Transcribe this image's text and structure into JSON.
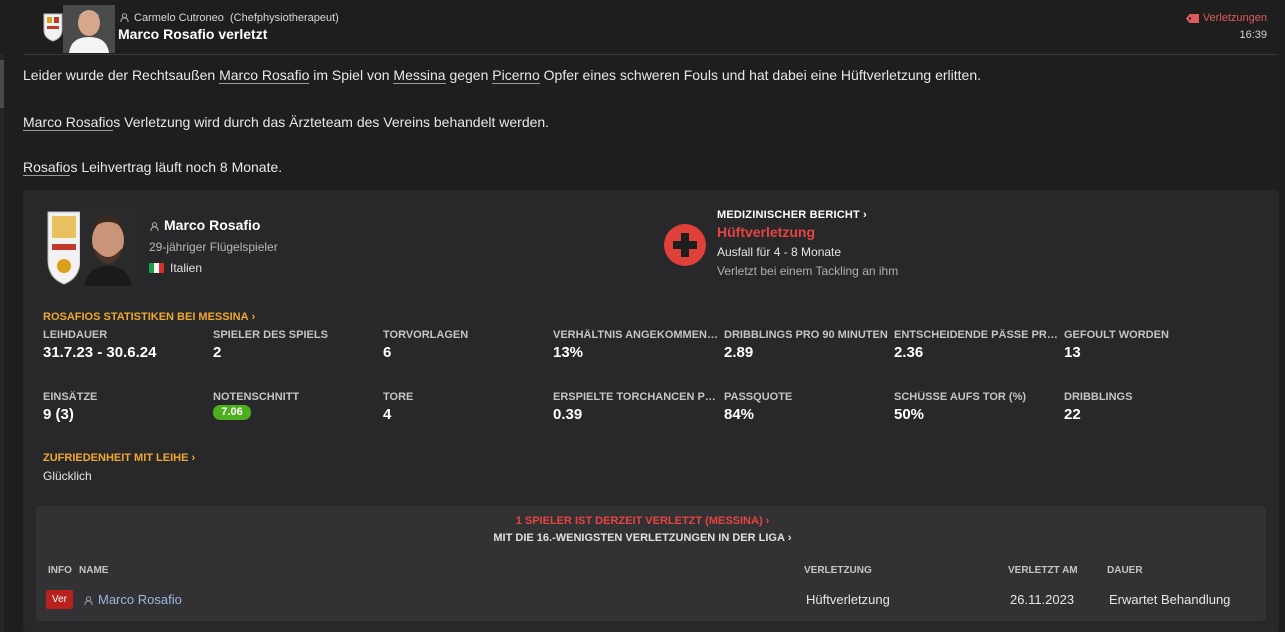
{
  "header": {
    "sender_name": "Carmelo Cutroneo",
    "sender_role": "(Chefphysiotherapeut)",
    "headline": "Marco Rosafio verletzt",
    "tag": "Verletzungen",
    "time": "16:39"
  },
  "message": {
    "p1": [
      "Leider wurde der Rechtsaußen ",
      "Marco Rosafio",
      " im Spiel von ",
      "Messina",
      " gegen ",
      "Picerno",
      " Opfer eines schweren Fouls und hat dabei eine Hüftverletzung erlitten."
    ],
    "p2": [
      "Marco Rosafio",
      "s Verletzung wird durch das Ärzteteam des Vereins behandelt werden."
    ],
    "p3": [
      "Rosafio",
      "s Leihvertrag läuft noch 8 Monate."
    ]
  },
  "player": {
    "name": "Marco Rosafio",
    "description": "29-jähriger Flügelspieler",
    "nationality": "Italien"
  },
  "medical": {
    "title": "MEDIZINISCHER BERICHT",
    "injury": "Hüftverletzung",
    "absence": "Ausfall für 4 - 8 Monate",
    "cause": "Verletzt bei einem Tackling an ihm"
  },
  "stats": {
    "title": "ROSAFIOS STATISTIKEN BEI MESSINA",
    "row1": [
      {
        "label": "LEIHDAUER",
        "value": "31.7.23 - 30.6.24"
      },
      {
        "label": "SPIELER DES SPIELS",
        "value": "2"
      },
      {
        "label": "TORVORLAGEN",
        "value": "6"
      },
      {
        "label": "VERHÄLTNIS ANGEKOMMENE...",
        "value": "13%"
      },
      {
        "label": "DRIBBLINGS PRO 90 MINUTEN",
        "value": "2.89"
      },
      {
        "label": "ENTSCHEIDENDE PÄSSE PRO...",
        "value": "2.36"
      },
      {
        "label": "GEFOULT WORDEN",
        "value": "13"
      }
    ],
    "row2": [
      {
        "label": "EINSÄTZE",
        "value": "9 (3)"
      },
      {
        "label": "NOTENSCHNITT",
        "value": "7.06"
      },
      {
        "label": "TORE",
        "value": "4"
      },
      {
        "label": "ERSPIELTE TORCHANCEN PRO...",
        "value": "0.39"
      },
      {
        "label": "PASSQUOTE",
        "value": "84%"
      },
      {
        "label": "SCHÜSSE AUFS TOR (%)",
        "value": "50%"
      },
      {
        "label": "DRIBBLINGS",
        "value": "22"
      }
    ]
  },
  "satisfaction": {
    "title": "ZUFRIEDENHEIT MIT LEIHE",
    "value": "Glücklich"
  },
  "injury_list": {
    "heading": "1 SPIELER IST DERZEIT VERLETZT (MESSINA)",
    "subheading": "MIT DIE 16.-WENIGSTEN VERLETZUNGEN IN DER LIGA",
    "columns": {
      "info": "INFO",
      "name": "NAME",
      "injury": "VERLETZUNG",
      "date": "VERLETZT AM",
      "duration": "DAUER"
    },
    "rows": [
      {
        "badge": "Ver",
        "name": "Marco Rosafio",
        "injury": "Hüftverletzung",
        "date": "26.11.2023",
        "duration": "Erwartet Behandlung"
      }
    ]
  },
  "colors": {
    "accent_orange": "#f0a830",
    "injury_red": "#e8443f",
    "rating_green": "#4caf1e",
    "link_blue": "#9ab8e0"
  }
}
